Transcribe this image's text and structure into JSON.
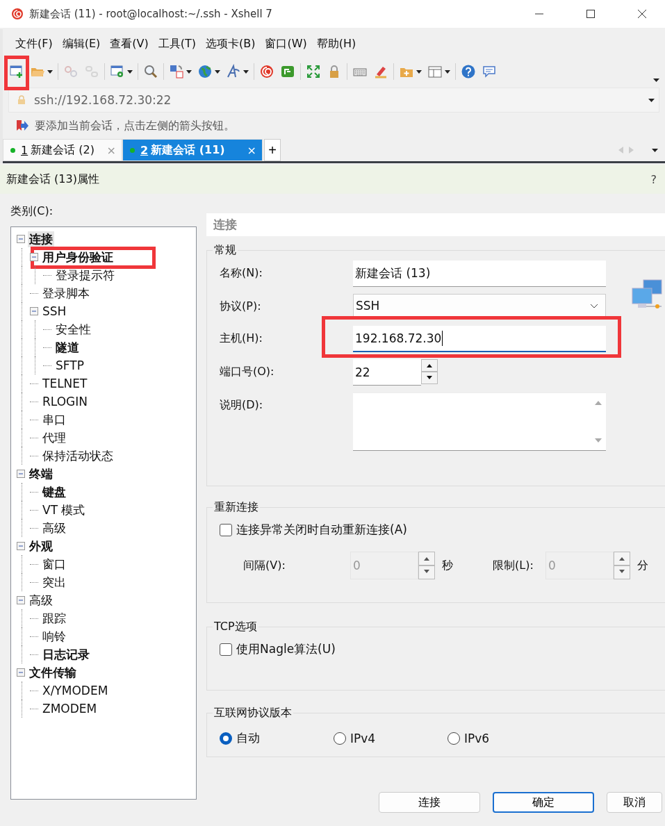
{
  "window": {
    "title": "新建会话 (11) - root@localhost:~/.ssh - Xshell 7"
  },
  "menu": [
    "文件(F)",
    "编辑(E)",
    "查看(V)",
    "工具(T)",
    "选项卡(B)",
    "窗口(W)",
    "帮助(H)"
  ],
  "toolbar": {
    "groups": [
      [
        {
          "kind": "new-session",
          "dropdown": false,
          "disabled": false,
          "highlighted": true
        },
        {
          "kind": "open",
          "dropdown": true,
          "disabled": false,
          "highlighted": false
        }
      ],
      [
        {
          "kind": "disconnect",
          "dropdown": false,
          "disabled": true,
          "highlighted": false
        },
        {
          "kind": "reconnect",
          "dropdown": false,
          "disabled": true,
          "highlighted": false
        }
      ],
      [
        {
          "kind": "properties",
          "dropdown": true,
          "disabled": false,
          "highlighted": false
        }
      ],
      [
        {
          "kind": "find",
          "dropdown": false,
          "disabled": false,
          "highlighted": false
        }
      ],
      [
        {
          "kind": "transfer",
          "dropdown": true,
          "disabled": false,
          "highlighted": false
        },
        {
          "kind": "globe",
          "dropdown": true,
          "disabled": false,
          "highlighted": false
        },
        {
          "kind": "font",
          "dropdown": true,
          "disabled": false,
          "highlighted": false
        }
      ],
      [
        {
          "kind": "xshell",
          "dropdown": false,
          "disabled": false,
          "highlighted": false
        },
        {
          "kind": "xftp",
          "dropdown": false,
          "disabled": false,
          "highlighted": false
        }
      ],
      [
        {
          "kind": "fullscreen",
          "dropdown": false,
          "disabled": false,
          "highlighted": false
        },
        {
          "kind": "lock",
          "dropdown": false,
          "disabled": false,
          "highlighted": false
        }
      ],
      [
        {
          "kind": "keyboard",
          "dropdown": false,
          "disabled": false,
          "highlighted": false
        },
        {
          "kind": "highlighter",
          "dropdown": false,
          "disabled": false,
          "highlighted": false
        }
      ],
      [
        {
          "kind": "new-folder",
          "dropdown": true,
          "disabled": false,
          "highlighted": false
        },
        {
          "kind": "layout",
          "dropdown": true,
          "disabled": false,
          "highlighted": false
        }
      ],
      [
        {
          "kind": "help",
          "dropdown": false,
          "disabled": false,
          "highlighted": false
        },
        {
          "kind": "chat",
          "dropdown": false,
          "disabled": false,
          "highlighted": false
        }
      ]
    ]
  },
  "address": {
    "value": "ssh://192.168.72.30:22"
  },
  "hint": "要添加当前会话，点击左侧的箭头按钮。",
  "tabs": [
    {
      "number": "1",
      "label": "新建会话 (2)",
      "close": "×",
      "selected": false,
      "connected": true
    },
    {
      "number": "2",
      "label": "新建会话 (11)",
      "close": "×",
      "selected": true,
      "connected": true
    }
  ],
  "tab_add": "+",
  "dialog": {
    "title": "新建会话 (13)属性",
    "help": "?",
    "category_label": "类别(C):"
  },
  "tree": {
    "items": [
      {
        "label": "连接",
        "bold": true,
        "selected": true,
        "highlighted": false,
        "expanded": true,
        "children": [
          {
            "label": "用户身份验证",
            "bold": true,
            "selected": false,
            "highlighted": true,
            "expanded": true,
            "children": [
              {
                "label": "登录提示符",
                "bold": false,
                "selected": false,
                "highlighted": false
              }
            ]
          },
          {
            "label": "登录脚本",
            "bold": false,
            "selected": false,
            "highlighted": false
          },
          {
            "label": "SSH",
            "bold": false,
            "selected": false,
            "highlighted": false,
            "expanded": true,
            "children": [
              {
                "label": "安全性",
                "bold": false,
                "selected": false,
                "highlighted": false
              },
              {
                "label": "隧道",
                "bold": true,
                "selected": false,
                "highlighted": false
              },
              {
                "label": "SFTP",
                "bold": false,
                "selected": false,
                "highlighted": false
              }
            ]
          },
          {
            "label": "TELNET",
            "bold": false,
            "selected": false,
            "highlighted": false
          },
          {
            "label": "RLOGIN",
            "bold": false,
            "selected": false,
            "highlighted": false
          },
          {
            "label": "串口",
            "bold": false,
            "selected": false,
            "highlighted": false
          },
          {
            "label": "代理",
            "bold": false,
            "selected": false,
            "highlighted": false
          },
          {
            "label": "保持活动状态",
            "bold": false,
            "selected": false,
            "highlighted": false
          }
        ]
      },
      {
        "label": "终端",
        "bold": true,
        "selected": false,
        "highlighted": false,
        "expanded": true,
        "children": [
          {
            "label": "键盘",
            "bold": true,
            "selected": false,
            "highlighted": false
          },
          {
            "label": "VT 模式",
            "bold": false,
            "selected": false,
            "highlighted": false
          },
          {
            "label": "高级",
            "bold": false,
            "selected": false,
            "highlighted": false
          }
        ]
      },
      {
        "label": "外观",
        "bold": true,
        "selected": false,
        "highlighted": false,
        "expanded": true,
        "children": [
          {
            "label": "窗口",
            "bold": false,
            "selected": false,
            "highlighted": false
          },
          {
            "label": "突出",
            "bold": false,
            "selected": false,
            "highlighted": false
          }
        ]
      },
      {
        "label": "高级",
        "bold": false,
        "selected": false,
        "highlighted": false,
        "expanded": true,
        "children": [
          {
            "label": "跟踪",
            "bold": false,
            "selected": false,
            "highlighted": false
          },
          {
            "label": "响铃",
            "bold": false,
            "selected": false,
            "highlighted": false
          },
          {
            "label": "日志记录",
            "bold": true,
            "selected": false,
            "highlighted": false
          }
        ]
      },
      {
        "label": "文件传输",
        "bold": true,
        "selected": false,
        "highlighted": false,
        "expanded": true,
        "children": [
          {
            "label": "X/YMODEM",
            "bold": false,
            "selected": false,
            "highlighted": false
          },
          {
            "label": "ZMODEM",
            "bold": false,
            "selected": false,
            "highlighted": false
          }
        ]
      }
    ]
  },
  "panel": {
    "heading": "连接",
    "general": {
      "title": "常规",
      "fields": [
        {
          "kind": "text",
          "label": "名称(N):",
          "value": "新建会话 (13)",
          "highlighted": false,
          "focused": false
        },
        {
          "kind": "select",
          "label": "协议(P):",
          "value": "SSH",
          "highlighted": false,
          "focused": false
        },
        {
          "kind": "text",
          "label": "主机(H):",
          "value": "192.168.72.30",
          "highlighted": true,
          "focused": true
        },
        {
          "kind": "spin",
          "label": "端口号(O):",
          "value": "22",
          "highlighted": false,
          "focused": false
        },
        {
          "kind": "textarea",
          "label": "说明(D):",
          "highlighted": false,
          "focused": false
        }
      ]
    },
    "reconnect": {
      "title": "重新连接",
      "checkbox": {
        "label": "连接异常关闭时自动重新连接(A)",
        "checked": false
      },
      "interval": {
        "label": "间隔(V):",
        "value": "0",
        "unit": "秒",
        "disabled": true
      },
      "limit": {
        "label": "限制(L):",
        "value": "0",
        "unit": "分",
        "disabled": true
      }
    },
    "tcp": {
      "title": "TCP选项",
      "checkbox": {
        "label": "使用Nagle算法(U)",
        "checked": false
      }
    },
    "ip": {
      "title": "互联网协议版本",
      "options": [
        {
          "label": "自动",
          "selected": true
        },
        {
          "label": "IPv4",
          "selected": false
        },
        {
          "label": "IPv6",
          "selected": false
        }
      ]
    }
  },
  "buttons": [
    {
      "label": "连接",
      "default": false
    },
    {
      "label": "确定",
      "default": true
    },
    {
      "label": "取消",
      "default": false
    }
  ]
}
